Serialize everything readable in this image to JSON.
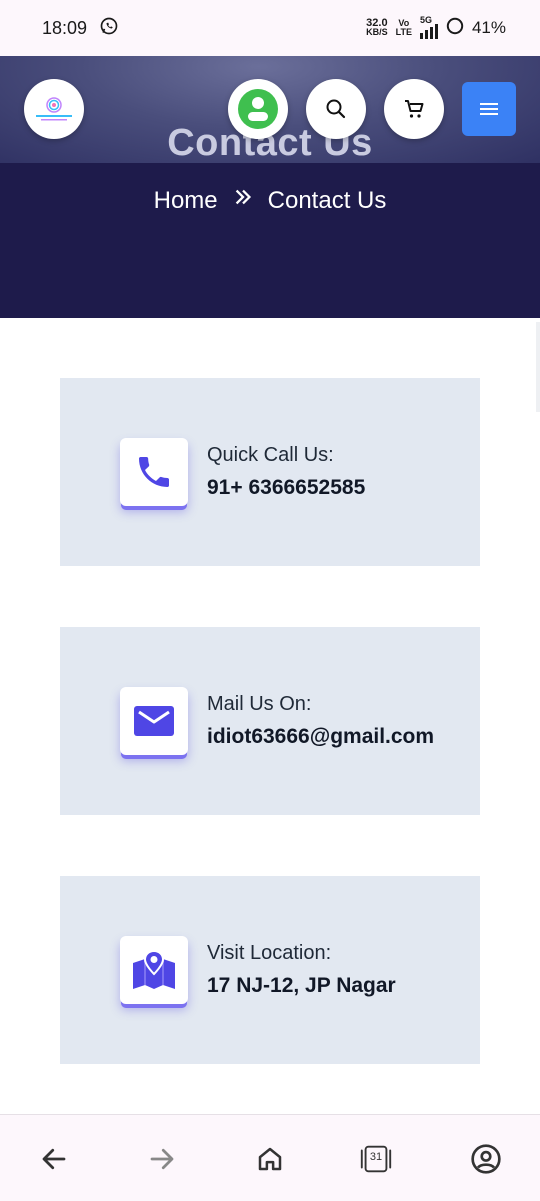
{
  "status": {
    "time": "18:09",
    "speed_top": "32.0",
    "speed_bottom": "KB/S",
    "net_top": "Vo",
    "net_bottom": "LTE",
    "network_type": "5G",
    "battery": "41%"
  },
  "header": {
    "title": "Contact Us",
    "breadcrumb_home": "Home",
    "breadcrumb_current": "Contact Us"
  },
  "colors": {
    "hero_bg": "#1e1b4b",
    "accent": "#4f46e5",
    "menu_button": "#3b82f6",
    "profile": "#3fbf4f",
    "card_bg": "#e2e8f1"
  },
  "cards": [
    {
      "icon": "phone-icon",
      "label": "Quick Call Us:",
      "value": "91+ 6366652585"
    },
    {
      "icon": "mail-icon",
      "label": "Mail Us On:",
      "value": "idiot63666@gmail.com"
    },
    {
      "icon": "map-icon",
      "label": "Visit Location:",
      "value": "17 NJ-12, JP Nagar"
    }
  ],
  "navbar": {
    "tabs_count": "31"
  }
}
